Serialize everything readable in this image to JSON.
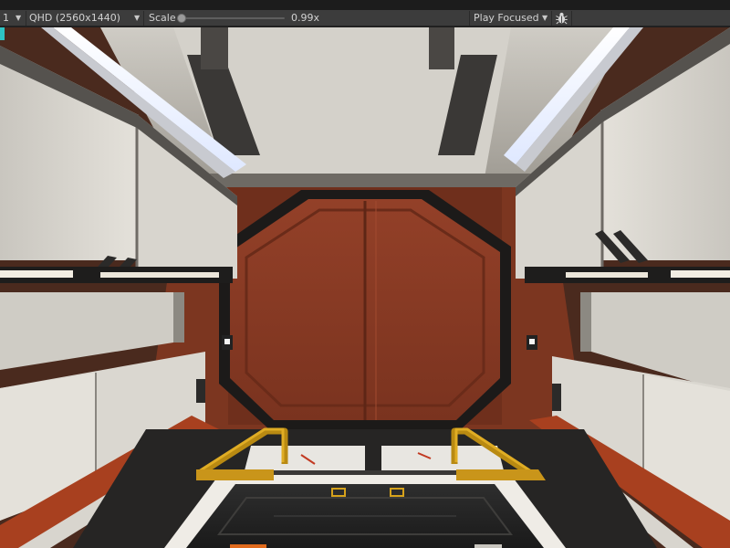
{
  "toolbar": {
    "display_index": "1",
    "resolution": "QHD (2560x1440)",
    "scale_label": "Scale",
    "scale_value_text": "0.99x",
    "scale_level": 0.0,
    "play_mode": "Play Focused"
  },
  "icons": {
    "dropdown": "caret-down-icon",
    "bug": "bug-icon"
  },
  "colors": {
    "toolbar_bg": "#3c3c3c",
    "door_red": "#8a3a22",
    "panel_white": "#d9d6cf",
    "rail_yellow": "#d4a21a",
    "gizmo_cyan": "#2ec4c4"
  }
}
